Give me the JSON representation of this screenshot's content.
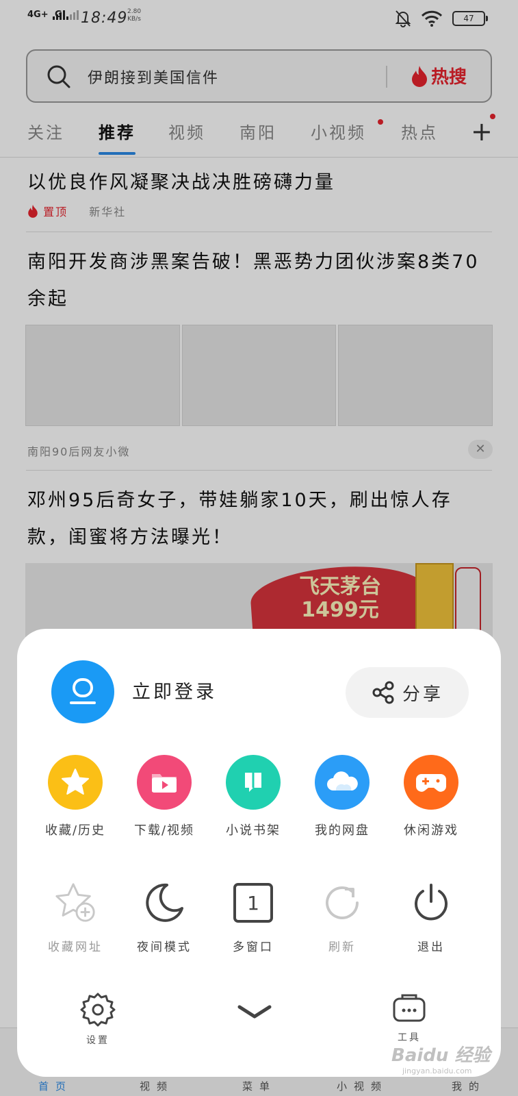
{
  "status_bar": {
    "network1": "4G+",
    "network2": "G",
    "time": "18:49",
    "speed_value": "2.80",
    "speed_unit": "KB/s",
    "battery": "47",
    "icons": [
      "mute-bell-icon",
      "wifi-icon",
      "battery-icon"
    ]
  },
  "search": {
    "query": "伊朗接到美国信件",
    "hot_label": "热搜",
    "accent_color": "#e8242e"
  },
  "tabs": [
    {
      "label": "关注"
    },
    {
      "label": "推荐",
      "active": true
    },
    {
      "label": "视频"
    },
    {
      "label": "南阳"
    },
    {
      "label": "小视频",
      "badge": true
    },
    {
      "label": "热点"
    }
  ],
  "feed": [
    {
      "title": "以优良作风凝聚决战决胜磅礴力量",
      "tag": "置顶",
      "source": "新华社"
    },
    {
      "title": "南阳开发商涉黑案告破！黑恶势力团伙涉案8类70余起",
      "source": "南阳90后网友小微"
    },
    {
      "title": "邓州95后奇女子，带娃躺家10天，刷出惊人存款，闺蜜将方法曝光！",
      "ad_text_line1": "飞天茅台",
      "ad_text_line2": "1499元"
    }
  ],
  "menu": {
    "login_label": "立即登录",
    "share_label": "分享",
    "features": [
      {
        "label": "收藏/历史",
        "icon": "star-icon",
        "color": "#fbbf16"
      },
      {
        "label": "下载/视频",
        "icon": "play-folder-icon",
        "color": "#f24a78"
      },
      {
        "label": "小说书架",
        "icon": "book-icon",
        "color": "#20d0b0"
      },
      {
        "label": "我的网盘",
        "icon": "cloud-icon",
        "color": "#2b9df7"
      },
      {
        "label": "休闲游戏",
        "icon": "gamepad-icon",
        "color": "#ff6a1a"
      }
    ],
    "tools": [
      {
        "label": "收藏网址",
        "icon": "star-add-icon",
        "disabled": true
      },
      {
        "label": "夜间模式",
        "icon": "moon-icon"
      },
      {
        "label": "多窗口",
        "icon": "window-count-icon",
        "count": "1"
      },
      {
        "label": "刷新",
        "icon": "refresh-icon",
        "disabled": true
      },
      {
        "label": "退出",
        "icon": "power-icon"
      }
    ],
    "footer": {
      "settings_label": "设置",
      "tools_label": "工具"
    }
  },
  "bottom_nav": [
    {
      "label": "首页",
      "active": true
    },
    {
      "label": "视频"
    },
    {
      "label": "菜单"
    },
    {
      "label": "小视频"
    },
    {
      "label": "我的"
    }
  ]
}
